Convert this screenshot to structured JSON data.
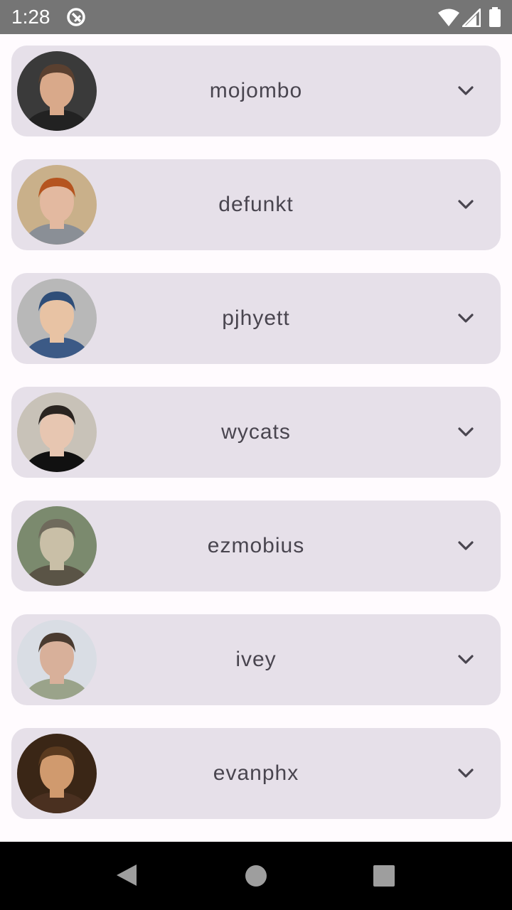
{
  "status_bar": {
    "time": "1:28",
    "icons": [
      "app-notification-icon",
      "wifi-icon",
      "cell-signal-icon",
      "battery-icon"
    ]
  },
  "users": [
    {
      "login": "mojombo",
      "avatar_icon": "avatar-photo",
      "colors": {
        "bg": "#3a3a3a",
        "skin": "#d9a98a",
        "hair": "#5a4030",
        "shirt": "#222222"
      }
    },
    {
      "login": "defunkt",
      "avatar_icon": "avatar-photo",
      "colors": {
        "bg": "#c9b08a",
        "skin": "#e3b9a0",
        "hair": "#b5541f",
        "shirt": "#8a8f96"
      }
    },
    {
      "login": "pjhyett",
      "avatar_icon": "avatar-photo",
      "colors": {
        "bg": "#b8b8b8",
        "skin": "#e8c3a4",
        "hair": "#2f4e78",
        "shirt": "#3c5a86"
      }
    },
    {
      "login": "wycats",
      "avatar_icon": "avatar-photo",
      "colors": {
        "bg": "#c8c2b8",
        "skin": "#e7c6b1",
        "hair": "#2a2420",
        "shirt": "#111111"
      }
    },
    {
      "login": "ezmobius",
      "avatar_icon": "avatar-artwork",
      "colors": {
        "bg": "#7b8a6e",
        "skin": "#c9bfa7",
        "hair": "#6f6a5c",
        "shirt": "#5a5446"
      }
    },
    {
      "login": "ivey",
      "avatar_icon": "avatar-photo",
      "colors": {
        "bg": "#d9dde4",
        "skin": "#d8b09a",
        "hair": "#4a3b30",
        "shirt": "#9aa38a"
      }
    },
    {
      "login": "evanphx",
      "avatar_icon": "avatar-photo",
      "colors": {
        "bg": "#3a2616",
        "skin": "#d09a6e",
        "hair": "#5a3a1f",
        "shirt": "#4a3020"
      }
    }
  ],
  "theme": {
    "card_bg": "#e6e0e9",
    "text": "#49454f",
    "status_bar_bg": "#757575"
  }
}
